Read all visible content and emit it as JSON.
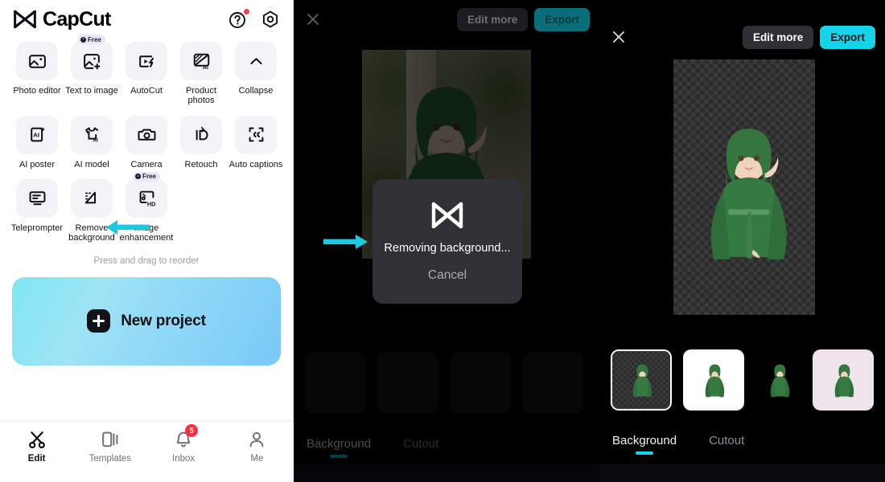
{
  "app": {
    "name": "CapCut",
    "logo_icon": "capcut-logo-icon"
  },
  "sidebar": {
    "header": {
      "help_icon": "help-circle-icon",
      "settings_icon": "gear-hexagon-icon",
      "help_has_notification": true
    },
    "tools": [
      {
        "label": "Photo editor",
        "icon": "photo-editor-icon",
        "badge": null
      },
      {
        "label": "Text to image",
        "icon": "text-to-image-icon",
        "badge": "Free"
      },
      {
        "label": "AutoCut",
        "icon": "autocut-icon",
        "badge": null
      },
      {
        "label": "Product photos",
        "icon": "product-photos-ai-icon",
        "badge": null
      },
      {
        "label": "Collapse",
        "icon": "chevron-up-icon",
        "badge": null
      },
      {
        "label": "AI poster",
        "icon": "ai-poster-icon",
        "badge": null
      },
      {
        "label": "AI model",
        "icon": "ai-model-shirt-icon",
        "badge": null
      },
      {
        "label": "Camera",
        "icon": "camera-icon",
        "badge": null
      },
      {
        "label": "Retouch",
        "icon": "retouch-icon",
        "badge": null
      },
      {
        "label": "Auto captions",
        "icon": "auto-captions-icon",
        "badge": null
      },
      {
        "label": "Teleprompter",
        "icon": "teleprompter-icon",
        "badge": null
      },
      {
        "label": "Remove background",
        "icon": "remove-background-icon",
        "badge": null
      },
      {
        "label": "Image enhancement",
        "icon": "image-enhancement-hd-icon",
        "badge": "Free"
      }
    ],
    "reorder_hint": "Press and drag to reorder",
    "new_project": {
      "label": "New project",
      "plus_icon": "plus-icon"
    },
    "bottom_nav": [
      {
        "label": "Edit",
        "icon": "scissors-icon",
        "active": true,
        "badge": null
      },
      {
        "label": "Templates",
        "icon": "templates-icon",
        "active": false,
        "badge": null
      },
      {
        "label": "Inbox",
        "icon": "bell-icon",
        "active": false,
        "badge": "5"
      },
      {
        "label": "Me",
        "icon": "person-icon",
        "active": false,
        "badge": null
      }
    ]
  },
  "center_panel": {
    "close_icon": "close-x-icon",
    "edit_more_label": "Edit more",
    "export_label": "Export",
    "dialog": {
      "logo_icon": "capcut-logo-icon",
      "status_text": "Removing background...",
      "cancel_label": "Cancel"
    },
    "tabs": [
      {
        "label": "Background",
        "active": true
      },
      {
        "label": "Cutout",
        "active": false
      }
    ],
    "thumbnail_count": 4
  },
  "right_panel": {
    "close_icon": "close-x-icon",
    "edit_more_label": "Edit more",
    "export_label": "Export",
    "tabs": [
      {
        "label": "Background",
        "active": true
      },
      {
        "label": "Cutout",
        "active": false
      }
    ],
    "thumbnails": [
      {
        "name": "transparent-checkerboard",
        "selected": true,
        "bg": "checker"
      },
      {
        "name": "white-background",
        "selected": false,
        "bg": "#ffffff"
      },
      {
        "name": "no-background",
        "selected": false,
        "bg": "transparent"
      },
      {
        "name": "lavender-background",
        "selected": false,
        "bg": "#efe4ec"
      },
      {
        "name": "partial-background",
        "selected": false,
        "bg": "#efe4ec"
      }
    ]
  },
  "annotations": {
    "arrow_color": "#1ec8e0",
    "arrows": [
      {
        "name": "arrow-to-remove-background",
        "points_to": "Remove background"
      },
      {
        "name": "arrow-to-preview",
        "points_to": "preview image"
      }
    ]
  },
  "colors": {
    "accent_cyan": "#13d4e8",
    "badge_red": "#ff2d41",
    "dialog_bg": "#2f3136",
    "panel_bg": "#000000",
    "tool_tile_bg": "#f1f3f6"
  }
}
